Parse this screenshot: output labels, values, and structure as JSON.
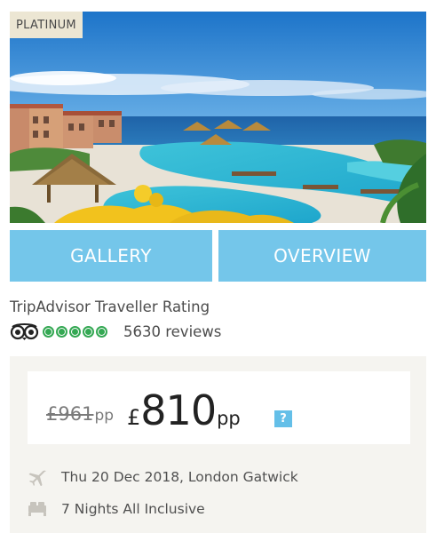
{
  "hero": {
    "badge": "PLATINUM",
    "image_icon": "resort-pool-photo"
  },
  "tabs": {
    "gallery_label": "GALLERY",
    "overview_label": "OVERVIEW"
  },
  "rating": {
    "label": "TripAdvisor Traveller Rating",
    "provider_icon": "tripadvisor-owl-icon",
    "score": 5,
    "max_score": 5,
    "reviews": "5630 reviews"
  },
  "price": {
    "old_currency": "£",
    "old_amount": "961",
    "old_suffix": "pp",
    "new_currency": "£",
    "new_amount": "810",
    "new_suffix": "pp",
    "help_label": "?"
  },
  "details": {
    "flight_icon": "plane-icon",
    "flight_text": "Thu 20 Dec 2018, London Gatwick",
    "board_icon": "bed-icon",
    "board_text": "7 Nights All Inclusive"
  },
  "colors": {
    "tab_bg": "#74c6ea",
    "badge_bg": "#ece6d3",
    "rating_green": "#34a853",
    "panel_bg": "#f5f4f0",
    "help_bg": "#64bfe8"
  }
}
